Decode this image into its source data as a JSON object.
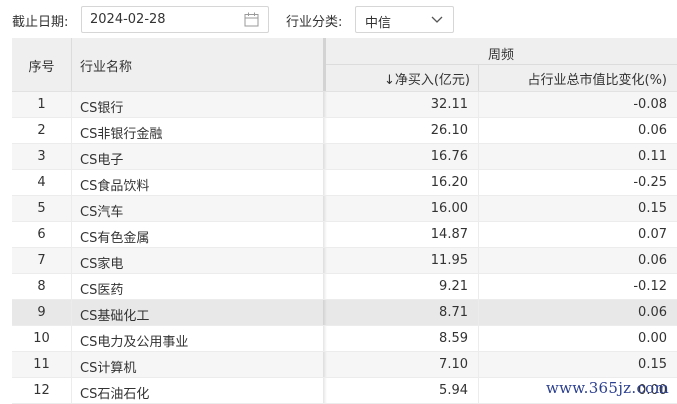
{
  "filters": {
    "date_label": "截止日期:",
    "date_value": "2024-02-28",
    "industry_label": "行业分类:",
    "industry_value": "中信"
  },
  "table": {
    "headers": {
      "index": "序号",
      "name": "行业名称",
      "group": "周频",
      "net_buy": "↓净买入(亿元)",
      "ratio_change": "占行业总市值比变化(%)"
    },
    "rows": [
      {
        "index": "1",
        "name": "CS银行",
        "net_buy": "32.11",
        "ratio_change": "-0.08"
      },
      {
        "index": "2",
        "name": "CS非银行金融",
        "net_buy": "26.10",
        "ratio_change": "0.06"
      },
      {
        "index": "3",
        "name": "CS电子",
        "net_buy": "16.76",
        "ratio_change": "0.11"
      },
      {
        "index": "4",
        "name": "CS食品饮料",
        "net_buy": "16.20",
        "ratio_change": "-0.25"
      },
      {
        "index": "5",
        "name": "CS汽车",
        "net_buy": "16.00",
        "ratio_change": "0.15"
      },
      {
        "index": "6",
        "name": "CS有色金属",
        "net_buy": "14.87",
        "ratio_change": "0.07"
      },
      {
        "index": "7",
        "name": "CS家电",
        "net_buy": "11.95",
        "ratio_change": "0.06"
      },
      {
        "index": "8",
        "name": "CS医药",
        "net_buy": "9.21",
        "ratio_change": "-0.12"
      },
      {
        "index": "9",
        "name": "CS基础化工",
        "net_buy": "8.71",
        "ratio_change": "0.06"
      },
      {
        "index": "10",
        "name": "CS电力及公用事业",
        "net_buy": "8.59",
        "ratio_change": "0.00"
      },
      {
        "index": "11",
        "name": "CS计算机",
        "net_buy": "7.10",
        "ratio_change": "0.15"
      },
      {
        "index": "12",
        "name": "CS石油石化",
        "net_buy": "5.94",
        "ratio_change": "0.00"
      }
    ],
    "highlighted_row": "9"
  },
  "watermark": "www.365jz.com",
  "icons": {
    "date_picker": "calendar-icon",
    "select": "chevron-down-icon"
  }
}
